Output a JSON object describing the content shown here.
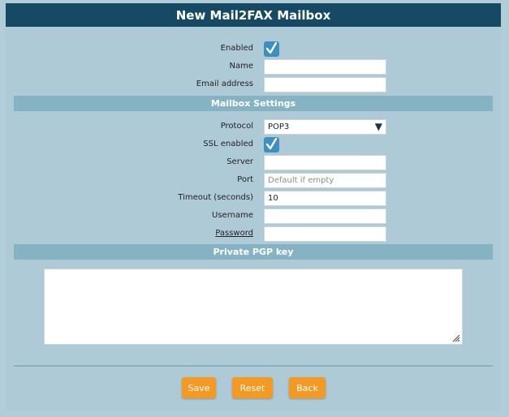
{
  "dialog": {
    "title": "New Mail2FAX Mailbox"
  },
  "form": {
    "enabled": {
      "label": "Enabled",
      "checked": true
    },
    "name": {
      "label": "Name",
      "value": ""
    },
    "email": {
      "label": "Email address",
      "value": ""
    }
  },
  "mailbox_settings": {
    "header": "Mailbox Settings",
    "protocol": {
      "label": "Protocol",
      "value": "POP3"
    },
    "ssl": {
      "label": "SSL enabled",
      "checked": true
    },
    "server": {
      "label": "Server",
      "value": ""
    },
    "port": {
      "label": "Port",
      "value": "",
      "placeholder": "Default if empty"
    },
    "timeout": {
      "label": "Timeout (seconds)",
      "value": "10"
    },
    "username": {
      "label": "Username",
      "value": ""
    },
    "password": {
      "label": "Password",
      "value": ""
    }
  },
  "pgp": {
    "header": "Private PGP key",
    "value": ""
  },
  "buttons": {
    "save": "Save",
    "reset": "Reset",
    "back": "Back"
  },
  "colors": {
    "title_bar": "#164a64",
    "background": "#adcad6",
    "section_header": "#86b3c3",
    "checkbox": "#3d8fc0",
    "button": "#f49a22"
  },
  "icons": {
    "checkbox": "checkmark-icon",
    "select": "caret-down-icon",
    "textarea": "resize-handle-icon"
  }
}
